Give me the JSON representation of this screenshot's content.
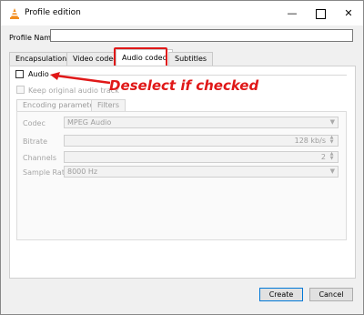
{
  "window": {
    "title": "Profile edition"
  },
  "profile": {
    "label": "Profile Name",
    "value": ""
  },
  "tabs": [
    {
      "label": "Encapsulation"
    },
    {
      "label": "Video codec"
    },
    {
      "label": "Audio codec",
      "selected": true
    },
    {
      "label": "Subtitles"
    }
  ],
  "audio": {
    "checkbox_label": "Audio",
    "checked": false,
    "keep_original_label": "Keep original audio track",
    "subtabs": [
      {
        "label": "Encoding parameters"
      },
      {
        "label": "Filters"
      }
    ],
    "codec": {
      "label": "Codec",
      "value": "MPEG Audio"
    },
    "bitrate": {
      "label": "Bitrate",
      "value": "128 kb/s"
    },
    "channels": {
      "label": "Channels",
      "value": "2"
    },
    "sample_rate": {
      "label": "Sample Rate",
      "value": "8000 Hz"
    }
  },
  "buttons": {
    "create": "Create",
    "cancel": "Cancel"
  },
  "annotation": {
    "text": "Deselect if checked",
    "color": "#e01818"
  },
  "icons": {
    "app": "vlc-cone-icon"
  }
}
